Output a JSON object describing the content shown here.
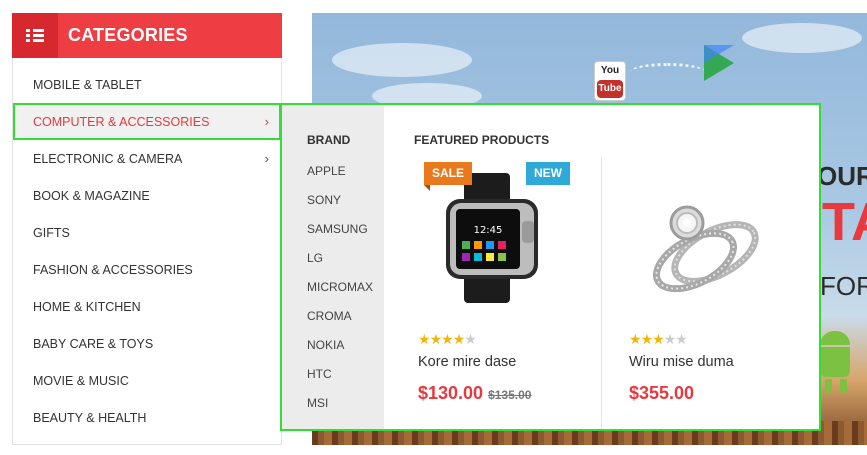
{
  "sidebar": {
    "title": "CATEGORIES",
    "header_icon": "list-icon",
    "items": [
      {
        "label": "MOBILE & TABLET",
        "has_submenu": false
      },
      {
        "label": "COMPUTER & ACCESSORIES",
        "has_submenu": true,
        "active": true
      },
      {
        "label": "ELECTRONIC & CAMERA",
        "has_submenu": true
      },
      {
        "label": "BOOK & MAGAZINE",
        "has_submenu": false
      },
      {
        "label": "GIFTS",
        "has_submenu": false
      },
      {
        "label": "FASHION & ACCESSORIES",
        "has_submenu": false
      },
      {
        "label": "HOME & KITCHEN",
        "has_submenu": false
      },
      {
        "label": "BABY CARE & TOYS",
        "has_submenu": false
      },
      {
        "label": "MOVIE & MUSIC",
        "has_submenu": false
      },
      {
        "label": "BEAUTY & HEALTH",
        "has_submenu": false
      }
    ],
    "chevron": "›"
  },
  "mega_menu": {
    "brand_heading": "BRAND",
    "brands": [
      "APPLE",
      "SONY",
      "SAMSUNG",
      "LG",
      "MICROMAX",
      "CROMA",
      "NOKIA",
      "HTC",
      "MSI"
    ],
    "featured_heading": "FEATURED PRODUCTS",
    "products": [
      {
        "name": "Kore mire dase",
        "price": "$130.00",
        "old_price": "$135.00",
        "rating": 4,
        "max_rating": 5,
        "badges": [
          "SALE",
          "NEW"
        ],
        "image": "smartwatch-image"
      },
      {
        "name": "Wiru mise duma",
        "price": "$355.00",
        "old_price": "",
        "rating": 3,
        "max_rating": 5,
        "badges": [],
        "image": "diamond-ring-image"
      }
    ]
  },
  "banner": {
    "youtube_top": "You",
    "youtube_bottom": "Tube",
    "text_line1": "OUR",
    "text_line2": "TA",
    "text_line3": "FOR"
  },
  "colors": {
    "brand_red": "#ee3d43",
    "highlight_green": "#33dd33",
    "sale_orange": "#e87a1d",
    "new_blue": "#2fa9d8",
    "star_gold": "#f2b705"
  }
}
